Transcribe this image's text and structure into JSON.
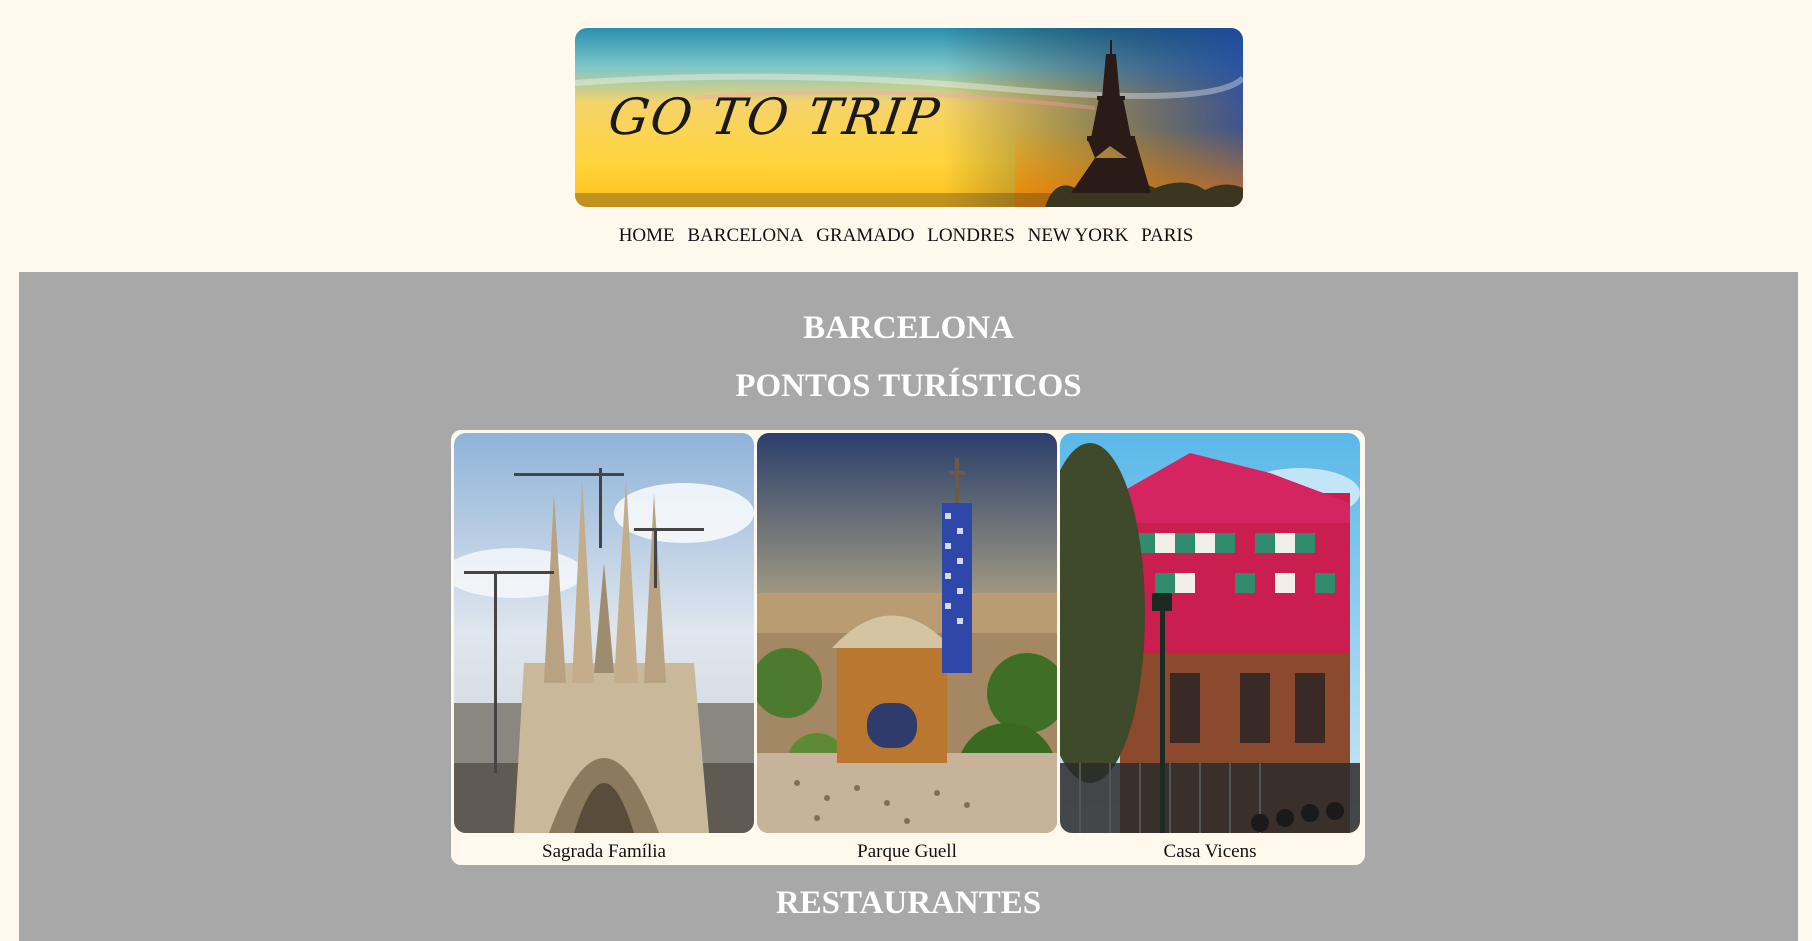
{
  "banner": {
    "title": "GO TO TRIP"
  },
  "nav": {
    "items": [
      "HOME",
      "BARCELONA",
      "GRAMADO",
      "LONDRES",
      "NEW YORK",
      "PARIS"
    ]
  },
  "main": {
    "city_title": "BARCELONA",
    "section_title": "PONTOS TURÍSTICOS",
    "attractions": [
      {
        "name": "Sagrada Família"
      },
      {
        "name": "Parque Guell"
      },
      {
        "name": "Casa Vicens"
      }
    ],
    "restaurants_title": "RESTAURANTES"
  },
  "colors": {
    "page_background": "#fef9ec",
    "main_background": "#a8a8a8",
    "heading_text": "#ffffff"
  }
}
